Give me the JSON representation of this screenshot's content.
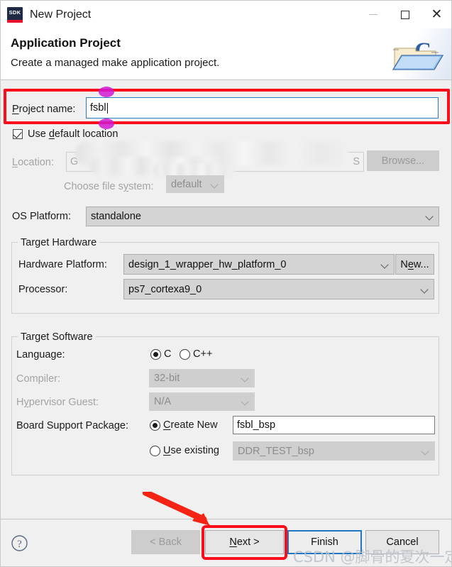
{
  "window": {
    "app_icon": "sdk-icon",
    "app_icon_text": "SDK",
    "title": "New Project",
    "minimize_label": "—",
    "maximize_label": "□",
    "close_label": "✕"
  },
  "header": {
    "title": "Application Project",
    "subtitle": "Create a managed make application project.",
    "banner_icon": "c-project-folder-icon"
  },
  "project_name": {
    "label": "Project name:",
    "label_mnemonic": "P",
    "value": "fsbl"
  },
  "default_location": {
    "label": "Use default location",
    "checked": true
  },
  "location": {
    "label": "Location:",
    "value_prefix": "G",
    "value_suffix": "S",
    "browse_label": "Browse...",
    "enabled": false
  },
  "file_system": {
    "label": "Choose file system:",
    "value": "default",
    "enabled": false
  },
  "os_platform": {
    "label": "OS Platform:",
    "value": "standalone"
  },
  "target_hardware": {
    "group_title": "Target Hardware",
    "hardware_platform": {
      "label": "Hardware Platform:",
      "value": "design_1_wrapper_hw_platform_0"
    },
    "new_button": "New...",
    "processor": {
      "label": "Processor:",
      "value": "ps7_cortexa9_0"
    }
  },
  "target_software": {
    "group_title": "Target Software",
    "language": {
      "label": "Language:",
      "options": [
        "C",
        "C++"
      ],
      "selected": "C"
    },
    "compiler": {
      "label": "Compiler:",
      "value": "32-bit",
      "enabled": false
    },
    "hypervisor_guest": {
      "label": "Hypervisor Guest:",
      "value": "N/A",
      "enabled": false
    },
    "bsp": {
      "label": "Board Support Package:",
      "create_new_label": "Create New",
      "create_new_value": "fsbl_bsp",
      "use_existing_label": "Use existing",
      "use_existing_value": "DDR_TEST_bsp",
      "selected": "Create New"
    }
  },
  "footer": {
    "help_icon": "help-question-icon",
    "back_label": "< Back",
    "back_enabled": false,
    "next_label": "Next >",
    "finish_label": "Finish",
    "cancel_label": "Cancel",
    "default_button": "Finish"
  },
  "annotations": {
    "highlight_color": "#fc0d1b",
    "handle_color": "#d119d1",
    "arrow_color": "#f52314",
    "boxes": [
      "project-name-row",
      "next-button"
    ],
    "arrow_points_to": "next-button"
  },
  "watermark": {
    "text": "CSDN @脚骨的夏次一定"
  }
}
